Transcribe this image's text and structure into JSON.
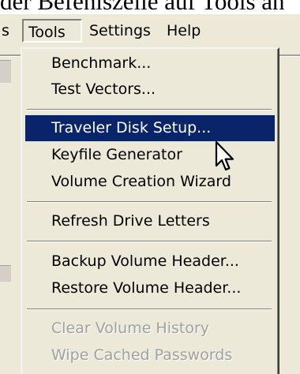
{
  "heading": "der Befehlszeile auf Tools an",
  "menubar": {
    "partial_left": "s",
    "tools": "Tools",
    "settings": "Settings",
    "help": "Help"
  },
  "tools_menu": {
    "items": [
      {
        "label": "Benchmark...",
        "state": "normal"
      },
      {
        "label": "Test Vectors...",
        "state": "normal"
      },
      {
        "label": "Traveler Disk Setup...",
        "state": "highlighted"
      },
      {
        "label": "Keyfile Generator",
        "state": "normal"
      },
      {
        "label": "Volume Creation Wizard",
        "state": "normal"
      },
      {
        "label": "Refresh Drive Letters",
        "state": "normal"
      },
      {
        "label": "Backup Volume Header...",
        "state": "normal"
      },
      {
        "label": "Restore Volume Header...",
        "state": "normal"
      },
      {
        "label": "Clear Volume History",
        "state": "disabled"
      },
      {
        "label": "Wipe Cached Passwords",
        "state": "disabled"
      }
    ]
  },
  "colors": {
    "highlight": "#0a246a",
    "menu_bg": "#ece9d8",
    "disabled_text": "#a0a0a0"
  },
  "cursor_icon": "arrow-pointer-icon"
}
